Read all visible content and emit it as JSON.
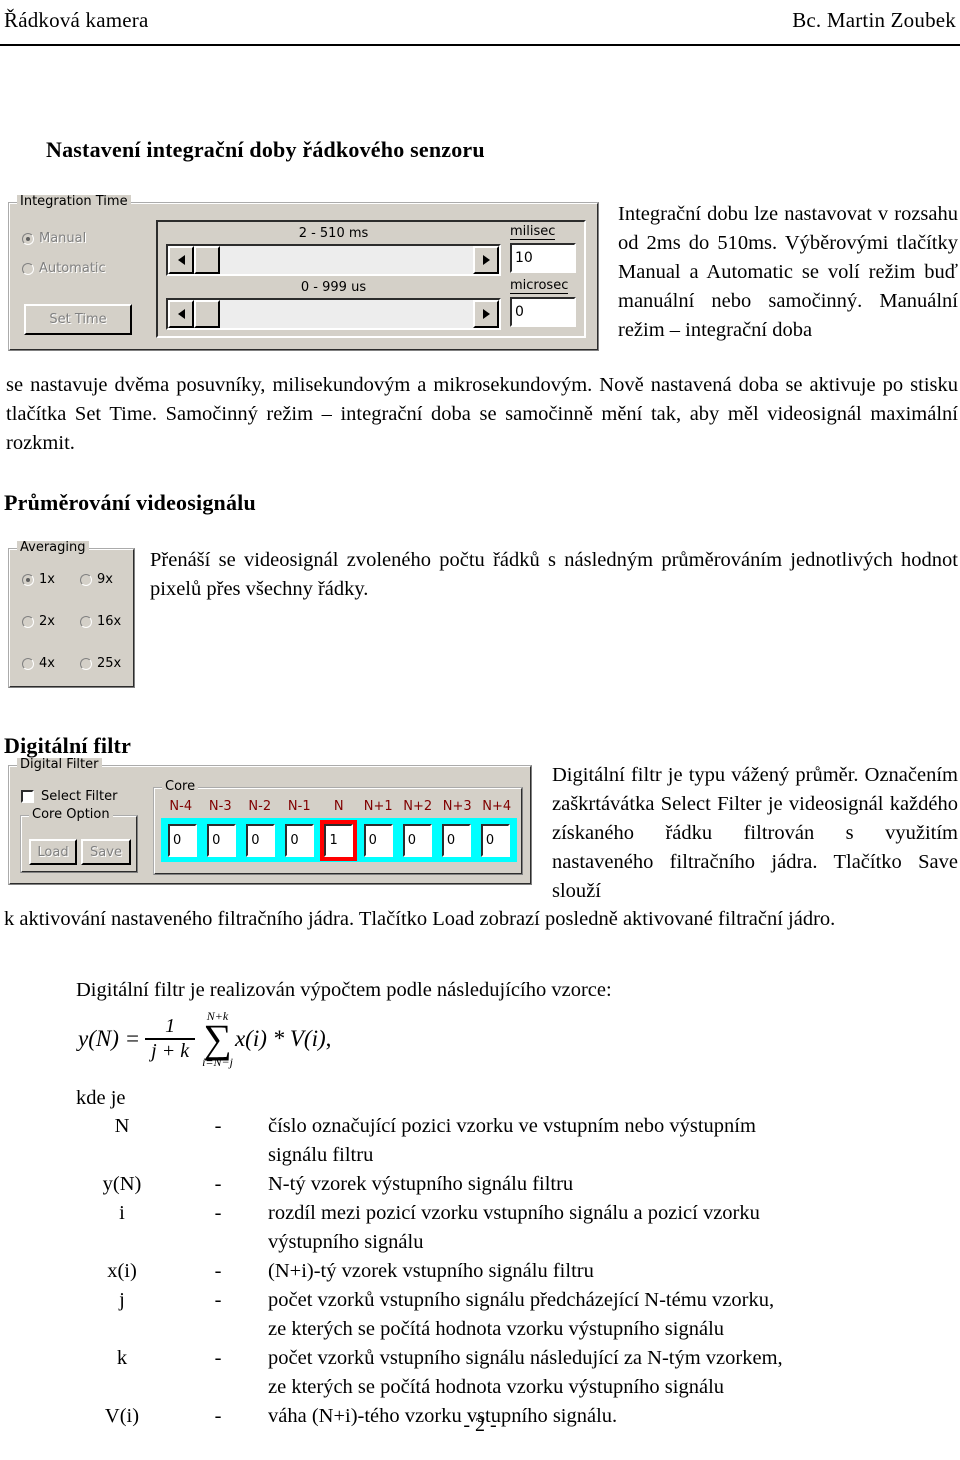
{
  "header": {
    "left": "Řádková kamera",
    "right": "Bc. Martin Zoubek"
  },
  "sections": {
    "integration": {
      "heading": "Nastavení integrační doby řádkového senzoru",
      "paragraph": "Integrační dobu lze nastavovat v rozsahu od 2ms do 510ms. Výběrovými tlačítky Manual a Automatic se volí režim buď manuální nebo samočinný. Manuální režim – integrační doba",
      "paragraph_full": "se nastavuje dvěma posuvníky, milisekundovým a mikrosekundovým. Nově nastavená doba se aktivuje po stisku tlačítka Set Time. Samočinný režim – integrační doba se samočinně mění tak, aby měl videosignál maximální rozkmit.",
      "widget": {
        "group_title": "Integration Time",
        "radio_manual": "Manual",
        "radio_automatic": "Automatic",
        "set_time_button": "Set Time",
        "slider_ms_range": "2 - 510 ms",
        "slider_us_range": "0 - 999 us",
        "milisec_label": "milisec",
        "milisec_value": "10",
        "microsec_label": "microsec",
        "microsec_value": "0"
      }
    },
    "averaging": {
      "heading": "Průměrování videosignálu",
      "paragraph": "Přenáší se videosignál zvoleného počtu řádků s následným průměrováním jednotlivých hodnot pixelů přes všechny řádky.",
      "widget": {
        "group_title": "Averaging",
        "options": [
          {
            "label": "1x",
            "selected": true
          },
          {
            "label": "9x",
            "selected": false
          },
          {
            "label": "2x",
            "selected": false
          },
          {
            "label": "16x",
            "selected": false
          },
          {
            "label": "4x",
            "selected": false
          },
          {
            "label": "25x",
            "selected": false
          }
        ]
      }
    },
    "digital_filter": {
      "heading": "Digitální filtr",
      "paragraph_right": "Digitální filtr je typu vážený průměr. Označením zaškrtávátka Select Filter je videosignál každého získaného řádku filtrován s využitím nastaveného filtračního jádra. Tlačítko Save slouží",
      "paragraph_full": "k aktivování nastaveného filtračního jádra. Tlačítko Load zobrazí posledně aktivované filtrační jádro.",
      "widget": {
        "group_title": "Digital Filter",
        "select_filter_label": "Select Filter",
        "select_filter_checked": false,
        "core_option_title": "Core Option",
        "load_button": "Load",
        "save_button": "Save",
        "core_title": "Core",
        "core_labels": [
          "N-4",
          "N-3",
          "N-2",
          "N-1",
          "N",
          "N+1",
          "N+2",
          "N+3",
          "N+4"
        ],
        "core_values": [
          "0",
          "0",
          "0",
          "0",
          "1",
          "0",
          "0",
          "0",
          "0"
        ],
        "core_highlight_index": 4,
        "core_strip_color": "#00ffff",
        "core_highlight_color": "#ff0000",
        "core_label_color": "#800000"
      }
    },
    "formula": {
      "intro": "Digitální filtr je realizován výpočtem podle následujícího vzorce:",
      "lhs": "y(N) =",
      "frac_num": "1",
      "frac_den": "j + k",
      "sum_upper": "N+k",
      "sum_symbol": "∑",
      "sum_lower": "i=N−j",
      "body": "x(i) * V(i)",
      "comma": ",",
      "where": "kde je",
      "definitions": [
        {
          "symbol": "N",
          "dash": "-",
          "lines": [
            "číslo označující pozici vzorku ve vstupním nebo výstupním",
            "signálu filtru"
          ]
        },
        {
          "symbol": "y(N)",
          "dash": "-",
          "lines": [
            "N-tý vzorek výstupního signálu filtru"
          ]
        },
        {
          "symbol": "i",
          "dash": "-",
          "lines": [
            "rozdíl mezi pozicí vzorku vstupního signálu a pozicí vzorku",
            "výstupního signálu"
          ]
        },
        {
          "symbol": "x(i)",
          "dash": "-",
          "lines": [
            "(N+i)-tý vzorek vstupního signálu filtru"
          ]
        },
        {
          "symbol": "j",
          "dash": "-",
          "lines": [
            "počet vzorků vstupního signálu předcházející N-tému vzorku,",
            "ze kterých se počítá hodnota vzorku výstupního signálu"
          ]
        },
        {
          "symbol": "k",
          "dash": "-",
          "lines": [
            "počet vzorků vstupního signálu následující za N-tým vzorkem,",
            "ze kterých se počítá hodnota vzorku výstupního signálu"
          ]
        },
        {
          "symbol": "V(i)",
          "dash": "-",
          "lines": [
            "váha (N+i)-tého vzorku vstupního signálu."
          ]
        }
      ]
    }
  },
  "footer": {
    "page_number": "- 2 -"
  }
}
